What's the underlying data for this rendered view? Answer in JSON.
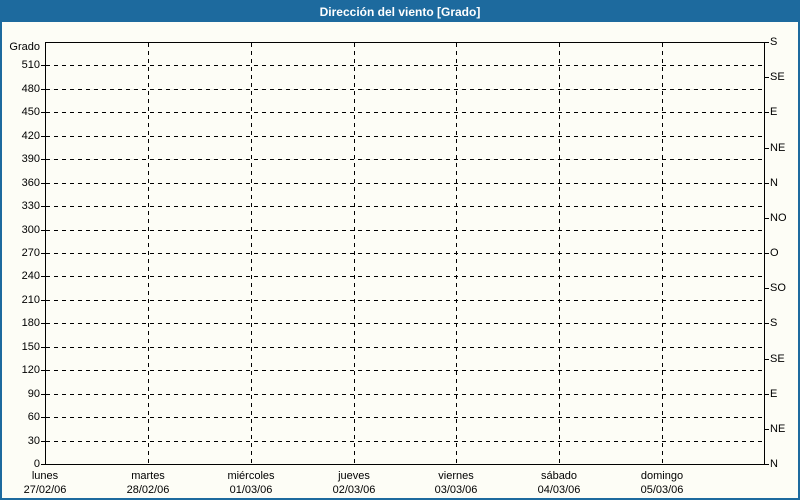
{
  "window": {
    "title": "Dirección del viento [Grado]"
  },
  "colors": {
    "titlebar_bg": "#1d6a9e",
    "titlebar_text": "#ffffff",
    "frame_border": "#1d6a9e",
    "background": "#fdfdf6",
    "axis_and_grid": "#000000",
    "label_text": "#000000"
  },
  "chart_data": {
    "type": "line",
    "title": "Dirección del viento [Grado]",
    "ylabel": "Grado",
    "ylim": [
      0,
      540
    ],
    "y_tick_step": 30,
    "grid": "dashed",
    "legend": "none",
    "y_left_ticks": [
      0,
      30,
      60,
      90,
      120,
      150,
      180,
      210,
      240,
      270,
      300,
      330,
      360,
      390,
      420,
      450,
      480,
      510
    ],
    "y_right_ticks": [
      {
        "value": 540,
        "label": "S"
      },
      {
        "value": 495,
        "label": "SE"
      },
      {
        "value": 450,
        "label": "E"
      },
      {
        "value": 405,
        "label": "NE"
      },
      {
        "value": 360,
        "label": "N"
      },
      {
        "value": 315,
        "label": "NO"
      },
      {
        "value": 270,
        "label": "O"
      },
      {
        "value": 225,
        "label": "SO"
      },
      {
        "value": 180,
        "label": "S"
      },
      {
        "value": 135,
        "label": "SE"
      },
      {
        "value": 90,
        "label": "E"
      },
      {
        "value": 45,
        "label": "NE"
      },
      {
        "value": 0,
        "label": "N"
      }
    ],
    "x_categories": [
      {
        "day": "lunes",
        "date": "27/02/06"
      },
      {
        "day": "martes",
        "date": "28/02/06"
      },
      {
        "day": "miércoles",
        "date": "01/03/06"
      },
      {
        "day": "jueves",
        "date": "02/03/06"
      },
      {
        "day": "viernes",
        "date": "03/03/06"
      },
      {
        "day": "sábado",
        "date": "04/03/06"
      },
      {
        "day": "domingo",
        "date": "05/03/06"
      }
    ],
    "series": []
  }
}
